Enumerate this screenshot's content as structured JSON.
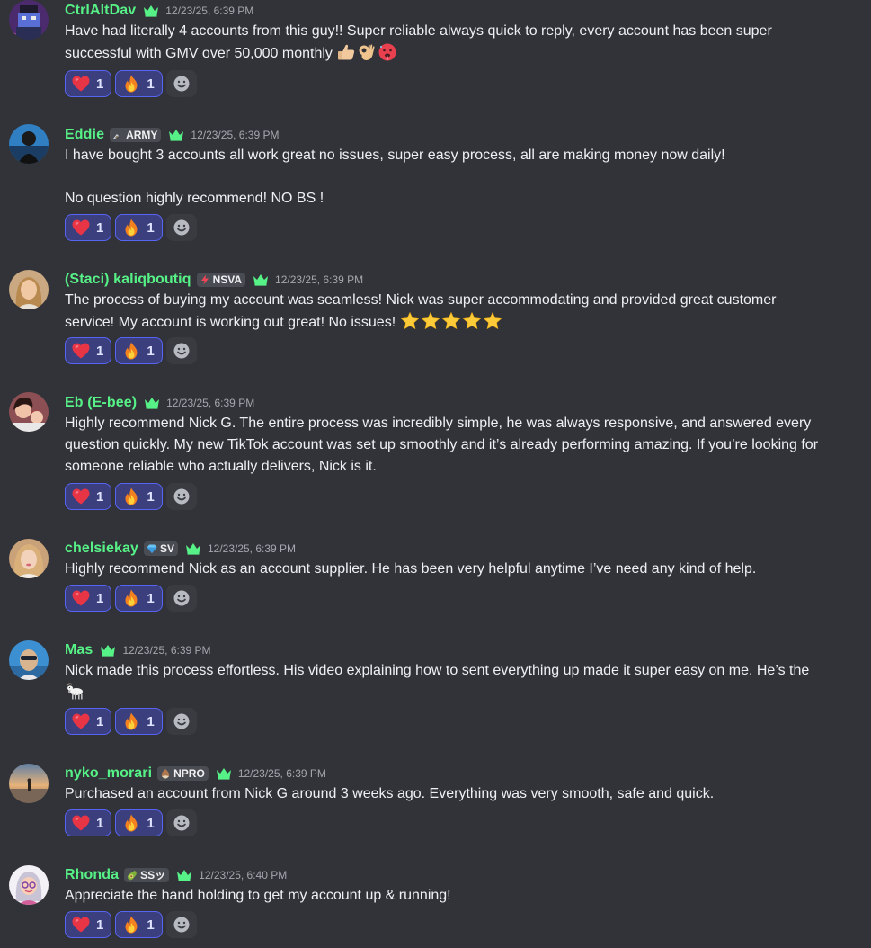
{
  "colors": {
    "background": "#313338",
    "username": "#57f287",
    "crown": "#57f287",
    "text": "#eef0f3",
    "timestamp": "#a4a7ae",
    "reaction_bg": "#3b3f7d",
    "reaction_border": "#5865f2"
  },
  "messages": [
    {
      "author": "CtrlAltDav",
      "timestamp": "12/23/25, 6:39 PM",
      "lines": [
        "Have had literally 4 accounts from this guy!! Super reliable always quick to reply, every account has been super",
        "successful with GMV over 50,000 monthly"
      ],
      "inline_emojis": [
        "thumbs-up-emoji",
        "ok-hand-emoji",
        "hot-face-emoji"
      ],
      "reactions": [
        {
          "emoji": "heart-emoji",
          "count": "1"
        },
        {
          "emoji": "fire-emoji",
          "count": "1"
        }
      ]
    },
    {
      "author": "Eddie",
      "tag": {
        "icon": "dagger-icon",
        "label": "ARMY"
      },
      "timestamp": "12/23/25, 6:39 PM",
      "lines": [
        "I have bought 3 accounts all work great no issues, super easy process, all are making money now daily!",
        "No question highly recommend! NO BS !"
      ],
      "reactions": [
        {
          "emoji": "heart-emoji",
          "count": "1"
        },
        {
          "emoji": "fire-emoji",
          "count": "1"
        }
      ]
    },
    {
      "author": "(Staci) kaliqboutiq",
      "tag": {
        "icon": "lightning-icon",
        "label": "NSVA"
      },
      "timestamp": "12/23/25, 6:39 PM",
      "lines": [
        "The process of buying my account was seamless! Nick was super accommodating and provided great customer",
        "service! My account is working out great! No issues!"
      ],
      "inline_emojis": [
        "star-emoji",
        "star-emoji",
        "star-emoji",
        "star-emoji",
        "star-emoji"
      ],
      "reactions": [
        {
          "emoji": "heart-emoji",
          "count": "1"
        },
        {
          "emoji": "fire-emoji",
          "count": "1"
        }
      ]
    },
    {
      "author": "Eb (E-bee)",
      "timestamp": "12/23/25, 6:39 PM",
      "lines": [
        "Highly recommend Nick G. The entire process was incredibly simple, he was always responsive, and answered every",
        "question quickly. My new TikTok account was set up smoothly and it’s already performing amazing. If you’re looking for",
        "someone reliable who actually delivers, Nick is it."
      ],
      "reactions": [
        {
          "emoji": "heart-emoji",
          "count": "1"
        },
        {
          "emoji": "fire-emoji",
          "count": "1"
        }
      ]
    },
    {
      "author": "chelsiekay",
      "tag": {
        "icon": "diamond-icon",
        "label": "SV"
      },
      "timestamp": "12/23/25, 6:39 PM",
      "lines": [
        "Highly recommend Nick as an account supplier. He has been very helpful anytime I’ve need any kind of help."
      ],
      "reactions": [
        {
          "emoji": "heart-emoji",
          "count": "1"
        },
        {
          "emoji": "fire-emoji",
          "count": "1"
        }
      ]
    },
    {
      "author": "Mas",
      "timestamp": "12/23/25, 6:39 PM",
      "lines": [
        "Nick made this process effortless. His video explaining how to sent everything up made it super easy on me. He’s the"
      ],
      "inline_emojis": [
        "goat-emoji"
      ],
      "reactions": [
        {
          "emoji": "heart-emoji",
          "count": "1"
        },
        {
          "emoji": "fire-emoji",
          "count": "1"
        }
      ]
    },
    {
      "author": "nyko_morari",
      "tag": {
        "icon": "chestnut-icon",
        "label": "NPRO"
      },
      "timestamp": "12/23/25, 6:39 PM",
      "lines": [
        "Purchased an account from Nick G around 3 weeks ago. Everything was very smooth, safe and quick."
      ],
      "reactions": [
        {
          "emoji": "heart-emoji",
          "count": "1"
        },
        {
          "emoji": "fire-emoji",
          "count": "1"
        }
      ]
    },
    {
      "author": "Rhonda",
      "tag": {
        "icon": "avocado-icon",
        "label": "SSッ"
      },
      "timestamp": "12/23/25, 6:40 PM",
      "lines": [
        "Appreciate the hand holding to get my account up & running!"
      ],
      "reactions": [
        {
          "emoji": "heart-emoji",
          "count": "1"
        },
        {
          "emoji": "fire-emoji",
          "count": "1"
        }
      ]
    }
  ]
}
